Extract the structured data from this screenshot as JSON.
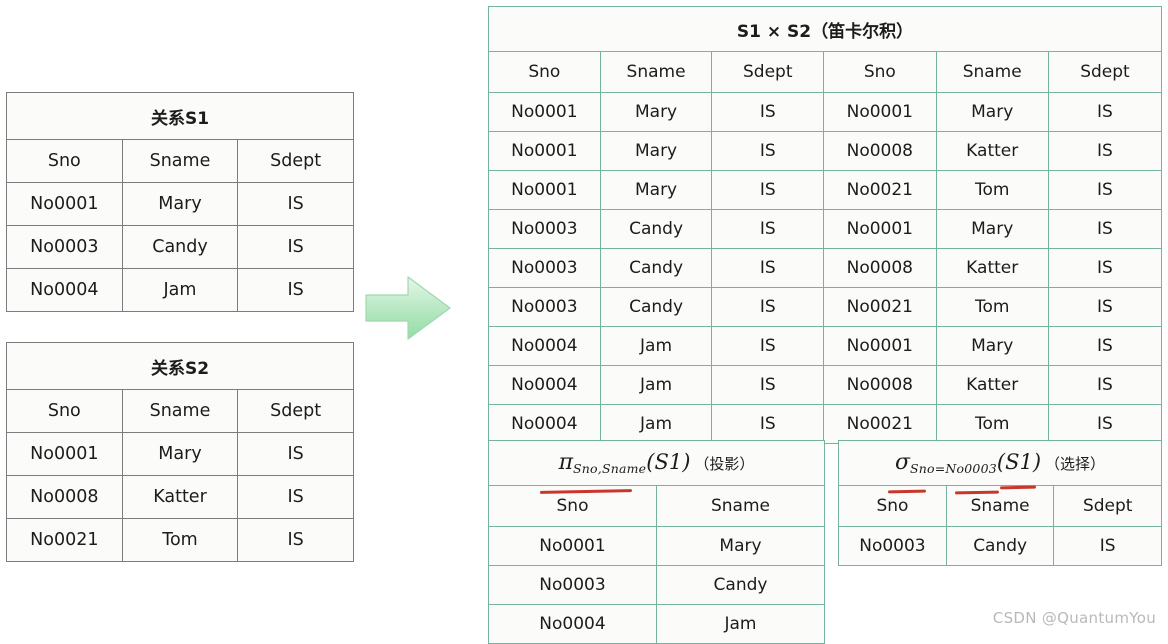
{
  "relation_s1": {
    "title": "关系S1",
    "columns": [
      "Sno",
      "Sname",
      "Sdept"
    ],
    "rows": [
      [
        "No0001",
        "Mary",
        "IS"
      ],
      [
        "No0003",
        "Candy",
        "IS"
      ],
      [
        "No0004",
        "Jam",
        "IS"
      ]
    ]
  },
  "relation_s2": {
    "title": "关系S2",
    "columns": [
      "Sno",
      "Sname",
      "Sdept"
    ],
    "rows": [
      [
        "No0001",
        "Mary",
        "IS"
      ],
      [
        "No0008",
        "Katter",
        "IS"
      ],
      [
        "No0021",
        "Tom",
        "IS"
      ]
    ]
  },
  "cartesian_product": {
    "title": "S1 × S2（笛卡尔积）",
    "columns": [
      "Sno",
      "Sname",
      "Sdept",
      "Sno",
      "Sname",
      "Sdept"
    ],
    "rows": [
      {
        "cells": [
          "No0001",
          "Mary",
          "IS",
          "No0001",
          "Mary",
          "IS"
        ],
        "right_color": "red"
      },
      {
        "cells": [
          "No0001",
          "Mary",
          "IS",
          "No0008",
          "Katter",
          "IS"
        ],
        "right_color": "red"
      },
      {
        "cells": [
          "No0001",
          "Mary",
          "IS",
          "No0021",
          "Tom",
          "IS"
        ],
        "right_color": "red"
      },
      {
        "cells": [
          "No0003",
          "Candy",
          "IS",
          "No0001",
          "Mary",
          "IS"
        ],
        "right_color": "black"
      },
      {
        "cells": [
          "No0003",
          "Candy",
          "IS",
          "No0008",
          "Katter",
          "IS"
        ],
        "right_color": "black"
      },
      {
        "cells": [
          "No0003",
          "Candy",
          "IS",
          "No0021",
          "Tom",
          "IS"
        ],
        "right_color": "black"
      },
      {
        "cells": [
          "No0004",
          "Jam",
          "IS",
          "No0001",
          "Mary",
          "IS"
        ],
        "right_color": "blue"
      },
      {
        "cells": [
          "No0004",
          "Jam",
          "IS",
          "No0008",
          "Katter",
          "IS"
        ],
        "right_color": "blue"
      },
      {
        "cells": [
          "No0004",
          "Jam",
          "IS",
          "No0021",
          "Tom",
          "IS"
        ],
        "right_color": "blue"
      }
    ]
  },
  "projection": {
    "operator": "π",
    "subscript": "Sno,Sname",
    "argument": "(S1)",
    "annotation": "（投影）",
    "columns": [
      "Sno",
      "Sname"
    ],
    "rows": [
      [
        "No0001",
        "Mary"
      ],
      [
        "No0003",
        "Candy"
      ],
      [
        "No0004",
        "Jam"
      ]
    ]
  },
  "selection": {
    "operator": "σ",
    "subscript": "Sno=No0003",
    "argument": "(S1)",
    "annotation": "（选择）",
    "columns": [
      "Sno",
      "Sname",
      "Sdept"
    ],
    "rows": [
      [
        "No0003",
        "Candy",
        "IS"
      ]
    ]
  },
  "arrow": {
    "name": "right-arrow",
    "color": "#9fe0ae"
  },
  "colors": {
    "red": "#e02020",
    "blue": "#2b2f8f",
    "teal_border": "#73b3a0",
    "gray_border": "#7c7c7c",
    "annotation_red": "#c9372c"
  },
  "watermark": "CSDN @QuantumYou"
}
